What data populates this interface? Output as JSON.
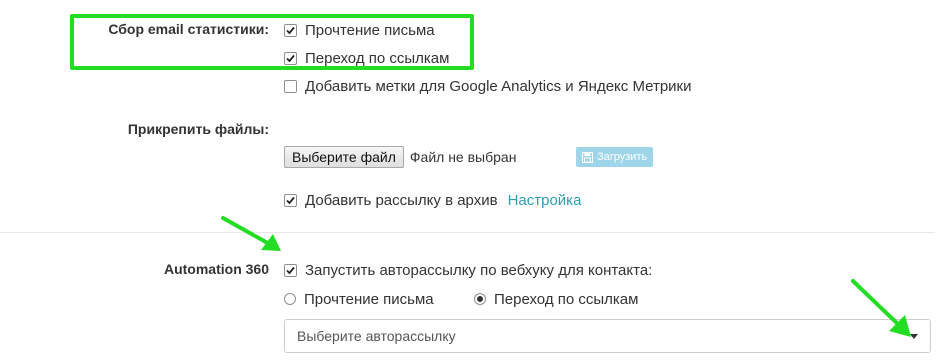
{
  "stats": {
    "label": "Сбор email статистики:",
    "read_letter": "Прочтение письма",
    "link_click": "Переход по ссылкам",
    "utm_marks": "Добавить метки для Google Analytics и Яндекс Метрики"
  },
  "attach": {
    "label": "Прикрепить файлы:",
    "choose_file": "Выберите файл",
    "no_file": "Файл не выбран",
    "upload": "Загрузить"
  },
  "archive": {
    "label": "Добавить рассылку в архив",
    "settings_link": "Настройка"
  },
  "automation": {
    "label": "Automation 360",
    "webhook_label": "Запустить авторассылку по вебхуку для контакта:",
    "option_read": "Прочтение письма",
    "option_click": "Переход по ссылкам",
    "select_placeholder": "Выберите авторассылку"
  },
  "colors": {
    "highlight": "#22dd22",
    "link": "#2a9fb4",
    "upload_button": "#9fd5e9"
  }
}
